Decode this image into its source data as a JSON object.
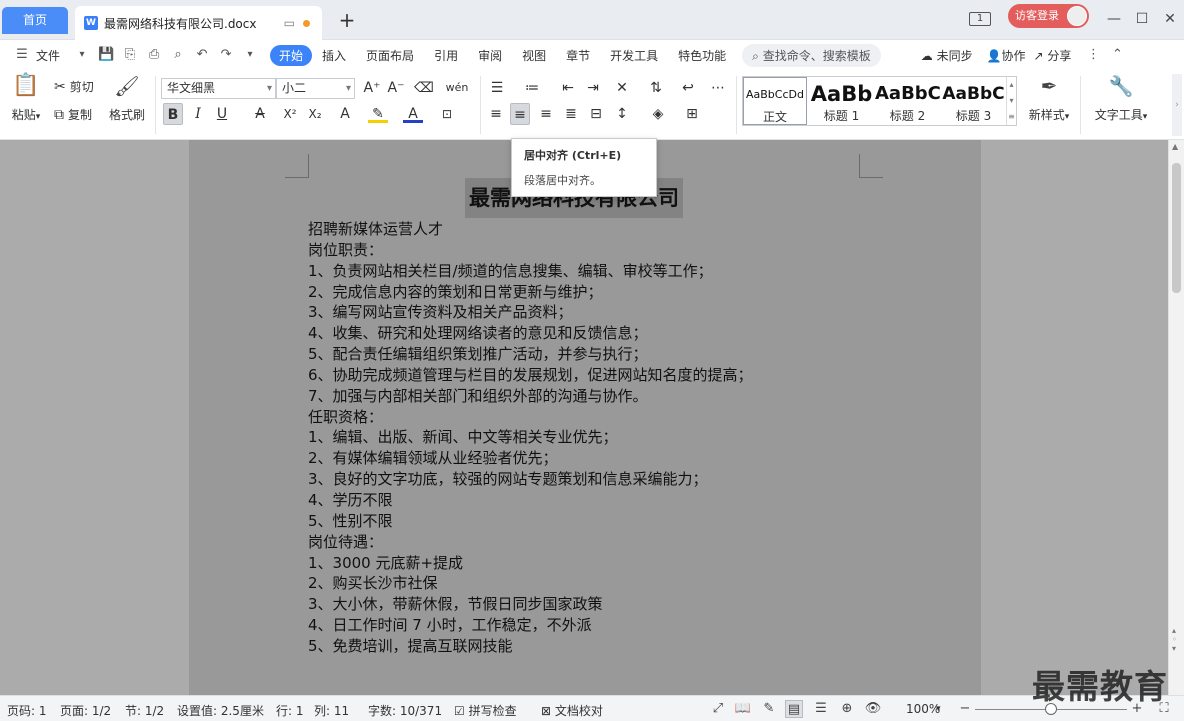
{
  "tabs": {
    "home": "首页",
    "doc_name": "最需网络科技有限公司.docx",
    "new_tab": "+"
  },
  "window": {
    "page_count_badge": "1",
    "login": "访客登录",
    "minimize": "—",
    "maximize": "☐",
    "close": "✕"
  },
  "menu": {
    "file": "文件",
    "items": [
      "开始",
      "插入",
      "页面布局",
      "引用",
      "审阅",
      "视图",
      "章节",
      "开发工具",
      "特色功能"
    ],
    "active": "开始",
    "search_placeholder": "查找命令、搜索模板",
    "sync": "未同步",
    "collab": "协作",
    "share": "分享"
  },
  "ribbon": {
    "paste": "粘贴",
    "cut": "剪切",
    "copy": "复制",
    "format_painter": "格式刷",
    "font_name": "华文细黑",
    "font_size": "小二",
    "styles": [
      {
        "preview": "AaBbCcDd",
        "label": "正文"
      },
      {
        "preview": "AaBb",
        "label": "标题 1"
      },
      {
        "preview": "AaBbC",
        "label": "标题 2"
      },
      {
        "preview": "AaBbC",
        "label": "标题 3"
      }
    ],
    "new_style": "新样式",
    "text_tools": "文字工具"
  },
  "tooltip": {
    "title": "居中对齐 (Ctrl+E)",
    "desc": "段落居中对齐。"
  },
  "document": {
    "title": "最需网络科技有限公司",
    "lines": [
      "招聘新媒体运营人才",
      "岗位职责：",
      "1、负责网站相关栏目/频道的信息搜集、编辑、审校等工作；",
      "2、完成信息内容的策划和日常更新与维护；",
      "3、编写网站宣传资料及相关产品资料；",
      "4、收集、研究和处理网络读者的意见和反馈信息；",
      "5、配合责任编辑组织策划推广活动，并参与执行；",
      "6、协助完成频道管理与栏目的发展规划，促进网站知名度的提高；",
      "7、加强与内部相关部门和组织外部的沟通与协作。",
      "任职资格：",
      "1、编辑、出版、新闻、中文等相关专业优先；",
      "2、有媒体编辑领域从业经验者优先；",
      "3、良好的文字功底，较强的网站专题策划和信息采编能力；",
      "4、学历不限",
      "5、性别不限",
      "岗位待遇：",
      "1、3000 元底薪+提成",
      "2、购买长沙市社保",
      "3、大小休，带薪休假，节假日同步国家政策",
      "4、日工作时间 7 小时，工作稳定，不外派",
      "5、免费培训，提高互联网技能"
    ]
  },
  "status": {
    "page_num": "页码: 1",
    "pages": "页面: 1/2",
    "section": "节: 1/2",
    "setting": "设置值: 2.5厘米",
    "row": "行: 1",
    "col": "列: 11",
    "words": "字数: 10/371",
    "spell": "拼写检查",
    "proof": "文档校对",
    "zoom": "100%"
  },
  "watermark": "最需教育"
}
